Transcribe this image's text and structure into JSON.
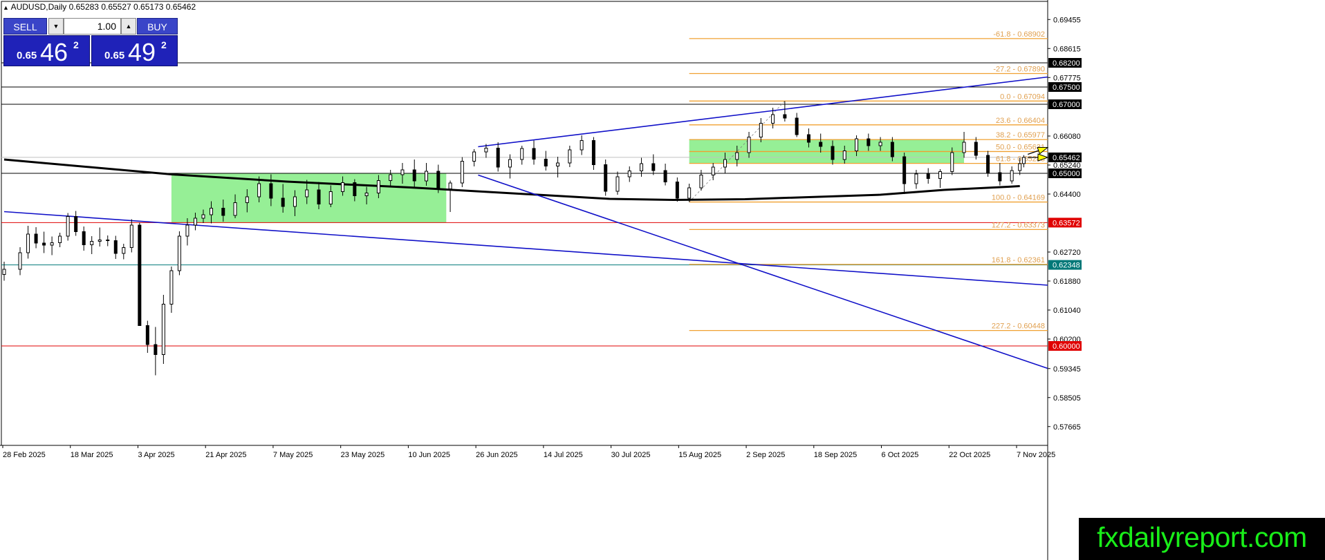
{
  "header": {
    "symbol": "AUDUSD",
    "timeframe": "Daily",
    "ohlc_text": "AUDUSD,Daily  0.65283 0.65527 0.65173 0.65462"
  },
  "trade_panel": {
    "sell_label": "SELL",
    "buy_label": "BUY",
    "lot_value": "1.00",
    "sell_small": "0.65",
    "sell_big": "46",
    "sell_sup": "2",
    "buy_small": "0.65",
    "buy_big": "49",
    "buy_sup": "2"
  },
  "watermark": "fxdailyreport.com",
  "colors": {
    "fib": "#f0a030",
    "fib_label": "#e0a050",
    "zone": "#90ee90",
    "trend": "#1010c8",
    "ma": "#000000",
    "red_line": "#e00000",
    "teal_line": "#007878",
    "level_badge": "#000000",
    "red_badge": "#e00000",
    "teal_badge": "#007878",
    "arrow": "#ffff00"
  },
  "chart_data": {
    "type": "candlestick",
    "symbol": "AUDUSD",
    "timeframe": "Daily",
    "last_price": 0.65462,
    "ohlc_last": {
      "open": 0.65283,
      "high": 0.65527,
      "low": 0.65173,
      "close": 0.65462
    },
    "ylim": [
      0.5712,
      0.6998
    ],
    "x_tick_labels": [
      "28 Feb 2025",
      "18 Mar 2025",
      "3 Apr 2025",
      "21 Apr 2025",
      "7 May 2025",
      "23 May 2025",
      "10 Jun 2025",
      "26 Jun 2025",
      "14 Jul 2025",
      "30 Jul 2025",
      "15 Aug 2025",
      "2 Sep 2025",
      "18 Sep 2025",
      "6 Oct 2025",
      "22 Oct 2025",
      "7 Nov 2025"
    ],
    "y_tick_labels": [
      "0.69455",
      "0.68615",
      "0.67775",
      "0.66080",
      "0.65240",
      "0.64400",
      "0.62720",
      "0.61880",
      "0.61040",
      "0.60200",
      "0.59345",
      "0.58505",
      "0.57665"
    ],
    "price_badges": [
      {
        "label": "0.68200",
        "value": 0.682,
        "style": "black"
      },
      {
        "label": "0.67500",
        "value": 0.675,
        "style": "black"
      },
      {
        "label": "0.67000",
        "value": 0.67,
        "style": "black"
      },
      {
        "label": "0.65462",
        "value": 0.65462,
        "style": "black"
      },
      {
        "label": "0.65000",
        "value": 0.65,
        "style": "black"
      },
      {
        "label": "0.63572",
        "value": 0.63572,
        "style": "red"
      },
      {
        "label": "0.62348",
        "value": 0.62348,
        "style": "teal"
      },
      {
        "label": "0.60000",
        "value": 0.6,
        "style": "red"
      }
    ],
    "horizontal_lines": [
      {
        "value": 0.682,
        "color": "black"
      },
      {
        "value": 0.675,
        "color": "black"
      },
      {
        "value": 0.67,
        "color": "black"
      },
      {
        "value": 0.65,
        "color": "black"
      },
      {
        "value": 0.63572,
        "color": "red"
      },
      {
        "value": 0.62348,
        "color": "teal"
      },
      {
        "value": 0.6,
        "color": "red"
      }
    ],
    "fibonacci": {
      "from_date": "19 Aug 2025",
      "levels": [
        {
          "label": "-61.8 - 0.68902",
          "value": 0.68902
        },
        {
          "label": "-27.2 - 0.67890",
          "value": 0.6789
        },
        {
          "label": "0.0 - 0.67094",
          "value": 0.67094
        },
        {
          "label": "23.6 - 0.66404",
          "value": 0.66404
        },
        {
          "label": "38.2 - 0.65977",
          "value": 0.65977
        },
        {
          "label": "50.0 - 0.65631",
          "value": 0.65631
        },
        {
          "label": "61.8 - 0.65288",
          "value": 0.65288
        },
        {
          "label": "100.0 - 0.64169",
          "value": 0.64169
        },
        {
          "label": "127.2 - 0.63373",
          "value": 0.63373
        },
        {
          "label": "161.8 - 0.62361",
          "value": 0.62361
        },
        {
          "label": "227.2 - 0.60448",
          "value": 0.60448
        }
      ]
    },
    "zones": [
      {
        "start": "11 Apr 2025",
        "end": "19 Jun 2025",
        "high": 0.65,
        "low": 0.63572
      },
      {
        "start": "19 Aug 2025",
        "end": "27 Oct 2025",
        "high": 0.65977,
        "low": 0.65288
      }
    ],
    "trendlines": [
      {
        "start": {
          "date": "28 Feb 2025",
          "price": 0.6389
        },
        "end": {
          "date": "17 Nov 2025",
          "price": 0.6176
        }
      },
      {
        "start": {
          "date": "27 Jun 2025",
          "price": 0.6577
        },
        "end": {
          "date": "17 Nov 2025",
          "price": 0.6779
        }
      },
      {
        "start": {
          "date": "27 Jun 2025",
          "price": 0.6495
        },
        "end": {
          "date": "17 Nov 2025",
          "price": 0.5935
        }
      }
    ],
    "moving_average": [
      {
        "date": "28 Feb 2025",
        "price": 0.654
      },
      {
        "date": "11 Apr 2025",
        "price": 0.6497
      },
      {
        "date": "10 May 2025",
        "price": 0.6476
      },
      {
        "date": "10 Jun 2025",
        "price": 0.6459
      },
      {
        "date": "30 Jul 2025",
        "price": 0.6426
      },
      {
        "date": "15 Aug 2025",
        "price": 0.6423
      },
      {
        "date": "2 Sep 2025",
        "price": 0.6425
      },
      {
        "date": "6 Oct 2025",
        "price": 0.6438
      },
      {
        "date": "22 Oct 2025",
        "price": 0.6452
      },
      {
        "date": "7 Nov 2025",
        "price": 0.6461
      },
      {
        "date": "10 Nov 2025",
        "price": 0.6463
      }
    ],
    "arrows": [
      {
        "start": {
          "date": "12 Nov 2025",
          "price": 0.6555
        },
        "end": {
          "date": "17 Nov 2025",
          "price": 0.6575
        }
      },
      {
        "start": {
          "date": "12 Nov 2025",
          "price": 0.6546
        },
        "end": {
          "date": "17 Nov 2025",
          "price": 0.6546
        }
      }
    ],
    "candles": [
      {
        "date": "28 Feb 2025",
        "open": 0.6207,
        "high": 0.6244,
        "low": 0.6189,
        "close": 0.6222
      },
      {
        "date": "4 Mar 2025",
        "open": 0.6222,
        "high": 0.6286,
        "low": 0.6205,
        "close": 0.627
      },
      {
        "date": "6 Mar 2025",
        "open": 0.627,
        "high": 0.6348,
        "low": 0.6253,
        "close": 0.6324
      },
      {
        "date": "8 Mar 2025",
        "open": 0.6324,
        "high": 0.6344,
        "low": 0.6283,
        "close": 0.6298
      },
      {
        "date": "10 Mar 2025",
        "open": 0.6298,
        "high": 0.6331,
        "low": 0.6269,
        "close": 0.6292
      },
      {
        "date": "12 Mar 2025",
        "open": 0.6292,
        "high": 0.6317,
        "low": 0.6263,
        "close": 0.6299
      },
      {
        "date": "14 Mar 2025",
        "open": 0.6299,
        "high": 0.6328,
        "low": 0.6286,
        "close": 0.6318
      },
      {
        "date": "16 Mar 2025",
        "open": 0.6318,
        "high": 0.6385,
        "low": 0.6305,
        "close": 0.6375
      },
      {
        "date": "18 Mar 2025",
        "open": 0.6375,
        "high": 0.6391,
        "low": 0.6319,
        "close": 0.6331
      },
      {
        "date": "20 Mar 2025",
        "open": 0.6331,
        "high": 0.6346,
        "low": 0.6276,
        "close": 0.6293
      },
      {
        "date": "22 Mar 2025",
        "open": 0.6293,
        "high": 0.6318,
        "low": 0.6266,
        "close": 0.6303
      },
      {
        "date": "24 Mar 2025",
        "open": 0.6303,
        "high": 0.6343,
        "low": 0.6288,
        "close": 0.6307
      },
      {
        "date": "26 Mar 2025",
        "open": 0.6307,
        "high": 0.632,
        "low": 0.6289,
        "close": 0.6305
      },
      {
        "date": "28 Mar 2025",
        "open": 0.6305,
        "high": 0.6319,
        "low": 0.6252,
        "close": 0.6268
      },
      {
        "date": "30 Mar 2025",
        "open": 0.6268,
        "high": 0.6296,
        "low": 0.6251,
        "close": 0.6285
      },
      {
        "date": "1 Apr 2025",
        "open": 0.6285,
        "high": 0.6367,
        "low": 0.6271,
        "close": 0.635
      },
      {
        "date": "3 Apr 2025",
        "open": 0.635,
        "high": 0.6357,
        "low": 0.6208,
        "close": 0.6059
      },
      {
        "date": "5 Apr 2025",
        "open": 0.6059,
        "high": 0.6073,
        "low": 0.598,
        "close": 0.6004
      },
      {
        "date": "7 Apr 2025",
        "open": 0.6004,
        "high": 0.6055,
        "low": 0.5915,
        "close": 0.5975
      },
      {
        "date": "9 Apr 2025",
        "open": 0.5975,
        "high": 0.6148,
        "low": 0.5948,
        "close": 0.6121
      },
      {
        "date": "11 Apr 2025",
        "open": 0.6121,
        "high": 0.623,
        "low": 0.6096,
        "close": 0.6218
      },
      {
        "date": "13 Apr 2025",
        "open": 0.6218,
        "high": 0.6332,
        "low": 0.6205,
        "close": 0.6318
      },
      {
        "date": "15 Apr 2025",
        "open": 0.6318,
        "high": 0.637,
        "low": 0.6291,
        "close": 0.635
      },
      {
        "date": "17 Apr 2025",
        "open": 0.635,
        "high": 0.6386,
        "low": 0.6335,
        "close": 0.637
      },
      {
        "date": "19 Apr 2025",
        "open": 0.637,
        "high": 0.6395,
        "low": 0.6356,
        "close": 0.638
      },
      {
        "date": "21 Apr 2025",
        "open": 0.638,
        "high": 0.6419,
        "low": 0.6355,
        "close": 0.6399
      },
      {
        "date": "24 Apr 2025",
        "open": 0.6399,
        "high": 0.6424,
        "low": 0.636,
        "close": 0.6378
      },
      {
        "date": "27 Apr 2025",
        "open": 0.6378,
        "high": 0.6439,
        "low": 0.637,
        "close": 0.6415
      },
      {
        "date": "30 Apr 2025",
        "open": 0.6415,
        "high": 0.6454,
        "low": 0.6387,
        "close": 0.6432
      },
      {
        "date": "3 May 2025",
        "open": 0.6432,
        "high": 0.6491,
        "low": 0.6416,
        "close": 0.647
      },
      {
        "date": "6 May 2025",
        "open": 0.647,
        "high": 0.6497,
        "low": 0.6405,
        "close": 0.6428
      },
      {
        "date": "9 May 2025",
        "open": 0.6428,
        "high": 0.6469,
        "low": 0.6386,
        "close": 0.6404
      },
      {
        "date": "12 May 2025",
        "open": 0.6404,
        "high": 0.6451,
        "low": 0.6376,
        "close": 0.6432
      },
      {
        "date": "15 May 2025",
        "open": 0.6432,
        "high": 0.6481,
        "low": 0.6411,
        "close": 0.6452
      },
      {
        "date": "18 May 2025",
        "open": 0.6452,
        "high": 0.6475,
        "low": 0.6396,
        "close": 0.6411
      },
      {
        "date": "21 May 2025",
        "open": 0.6411,
        "high": 0.6465,
        "low": 0.6402,
        "close": 0.6447
      },
      {
        "date": "24 May 2025",
        "open": 0.6447,
        "high": 0.6491,
        "low": 0.6435,
        "close": 0.6473
      },
      {
        "date": "27 May 2025",
        "open": 0.6473,
        "high": 0.6483,
        "low": 0.6419,
        "close": 0.6435
      },
      {
        "date": "30 May 2025",
        "open": 0.6435,
        "high": 0.6461,
        "low": 0.641,
        "close": 0.6443
      },
      {
        "date": "2 Jun 2025",
        "open": 0.6443,
        "high": 0.6495,
        "low": 0.6428,
        "close": 0.6479
      },
      {
        "date": "5 Jun 2025",
        "open": 0.6479,
        "high": 0.651,
        "low": 0.646,
        "close": 0.6496
      },
      {
        "date": "8 Jun 2025",
        "open": 0.6496,
        "high": 0.653,
        "low": 0.647,
        "close": 0.651
      },
      {
        "date": "11 Jun 2025",
        "open": 0.651,
        "high": 0.654,
        "low": 0.646,
        "close": 0.6478
      },
      {
        "date": "14 Jun 2025",
        "open": 0.6478,
        "high": 0.653,
        "low": 0.6464,
        "close": 0.6506
      },
      {
        "date": "17 Jun 2025",
        "open": 0.6506,
        "high": 0.6525,
        "low": 0.6443,
        "close": 0.6455
      },
      {
        "date": "20 Jun 2025",
        "open": 0.6455,
        "high": 0.6479,
        "low": 0.6388,
        "close": 0.6472
      },
      {
        "date": "23 Jun 2025",
        "open": 0.6472,
        "high": 0.6547,
        "low": 0.646,
        "close": 0.6535
      },
      {
        "date": "26 Jun 2025",
        "open": 0.6535,
        "high": 0.657,
        "low": 0.652,
        "close": 0.6562
      },
      {
        "date": "29 Jun 2025",
        "open": 0.6562,
        "high": 0.6585,
        "low": 0.6545,
        "close": 0.6573
      },
      {
        "date": "2 Jul 2025",
        "open": 0.6573,
        "high": 0.659,
        "low": 0.6505,
        "close": 0.6518
      },
      {
        "date": "5 Jul 2025",
        "open": 0.6518,
        "high": 0.6555,
        "low": 0.6485,
        "close": 0.654
      },
      {
        "date": "8 Jul 2025",
        "open": 0.654,
        "high": 0.658,
        "low": 0.6525,
        "close": 0.6572
      },
      {
        "date": "11 Jul 2025",
        "open": 0.6572,
        "high": 0.6595,
        "low": 0.6525,
        "close": 0.6541
      },
      {
        "date": "14 Jul 2025",
        "open": 0.6541,
        "high": 0.6565,
        "low": 0.6508,
        "close": 0.6521
      },
      {
        "date": "17 Jul 2025",
        "open": 0.6521,
        "high": 0.6548,
        "low": 0.6488,
        "close": 0.653
      },
      {
        "date": "20 Jul 2025",
        "open": 0.653,
        "high": 0.658,
        "low": 0.6518,
        "close": 0.6568
      },
      {
        "date": "23 Jul 2025",
        "open": 0.6568,
        "high": 0.661,
        "low": 0.6553,
        "close": 0.6595
      },
      {
        "date": "26 Jul 2025",
        "open": 0.6595,
        "high": 0.6605,
        "low": 0.651,
        "close": 0.6525
      },
      {
        "date": "29 Jul 2025",
        "open": 0.6525,
        "high": 0.654,
        "low": 0.6435,
        "close": 0.6448
      },
      {
        "date": "1 Aug 2025",
        "open": 0.6448,
        "high": 0.6505,
        "low": 0.6438,
        "close": 0.649
      },
      {
        "date": "4 Aug 2025",
        "open": 0.649,
        "high": 0.652,
        "low": 0.6475,
        "close": 0.6507
      },
      {
        "date": "7 Aug 2025",
        "open": 0.6507,
        "high": 0.6545,
        "low": 0.649,
        "close": 0.6528
      },
      {
        "date": "10 Aug 2025",
        "open": 0.6528,
        "high": 0.6555,
        "low": 0.6495,
        "close": 0.6508
      },
      {
        "date": "13 Aug 2025",
        "open": 0.6508,
        "high": 0.6528,
        "low": 0.6465,
        "close": 0.6475
      },
      {
        "date": "16 Aug 2025",
        "open": 0.6475,
        "high": 0.6488,
        "low": 0.6418,
        "close": 0.6428
      },
      {
        "date": "19 Aug 2025",
        "open": 0.6428,
        "high": 0.647,
        "low": 0.6417,
        "close": 0.6458
      },
      {
        "date": "22 Aug 2025",
        "open": 0.6458,
        "high": 0.651,
        "low": 0.645,
        "close": 0.6495
      },
      {
        "date": "25 Aug 2025",
        "open": 0.6495,
        "high": 0.653,
        "low": 0.648,
        "close": 0.6518
      },
      {
        "date": "28 Aug 2025",
        "open": 0.6518,
        "high": 0.656,
        "low": 0.65,
        "close": 0.654
      },
      {
        "date": "31 Aug 2025",
        "open": 0.654,
        "high": 0.658,
        "low": 0.652,
        "close": 0.656
      },
      {
        "date": "3 Sep 2025",
        "open": 0.656,
        "high": 0.662,
        "low": 0.6545,
        "close": 0.6605
      },
      {
        "date": "6 Sep 2025",
        "open": 0.6605,
        "high": 0.666,
        "low": 0.659,
        "close": 0.6645
      },
      {
        "date": "9 Sep 2025",
        "open": 0.6645,
        "high": 0.669,
        "low": 0.663,
        "close": 0.667
      },
      {
        "date": "12 Sep 2025",
        "open": 0.667,
        "high": 0.6709,
        "low": 0.665,
        "close": 0.666
      },
      {
        "date": "15 Sep 2025",
        "open": 0.666,
        "high": 0.6675,
        "low": 0.6605,
        "close": 0.6612
      },
      {
        "date": "18 Sep 2025",
        "open": 0.6612,
        "high": 0.663,
        "low": 0.6575,
        "close": 0.659
      },
      {
        "date": "21 Sep 2025",
        "open": 0.659,
        "high": 0.6615,
        "low": 0.656,
        "close": 0.6578
      },
      {
        "date": "24 Sep 2025",
        "open": 0.6578,
        "high": 0.6595,
        "low": 0.6525,
        "close": 0.654
      },
      {
        "date": "27 Sep 2025",
        "open": 0.654,
        "high": 0.658,
        "low": 0.6528,
        "close": 0.6565
      },
      {
        "date": "30 Sep 2025",
        "open": 0.6565,
        "high": 0.661,
        "low": 0.655,
        "close": 0.66
      },
      {
        "date": "3 Oct 2025",
        "open": 0.66,
        "high": 0.6615,
        "low": 0.6565,
        "close": 0.658
      },
      {
        "date": "6 Oct 2025",
        "open": 0.658,
        "high": 0.6605,
        "low": 0.6565,
        "close": 0.659
      },
      {
        "date": "9 Oct 2025",
        "open": 0.659,
        "high": 0.6605,
        "low": 0.6535,
        "close": 0.6548
      },
      {
        "date": "12 Oct 2025",
        "open": 0.6548,
        "high": 0.656,
        "low": 0.644,
        "close": 0.647
      },
      {
        "date": "15 Oct 2025",
        "open": 0.647,
        "high": 0.651,
        "low": 0.6455,
        "close": 0.6498
      },
      {
        "date": "18 Oct 2025",
        "open": 0.6498,
        "high": 0.6515,
        "low": 0.647,
        "close": 0.6485
      },
      {
        "date": "21 Oct 2025",
        "open": 0.6485,
        "high": 0.6512,
        "low": 0.6458,
        "close": 0.6505
      },
      {
        "date": "24 Oct 2025",
        "open": 0.6505,
        "high": 0.6575,
        "low": 0.6495,
        "close": 0.656
      },
      {
        "date": "27 Oct 2025",
        "open": 0.656,
        "high": 0.662,
        "low": 0.6545,
        "close": 0.659
      },
      {
        "date": "30 Oct 2025",
        "open": 0.659,
        "high": 0.6605,
        "low": 0.654,
        "close": 0.6552
      },
      {
        "date": "2 Nov 2025",
        "open": 0.6552,
        "high": 0.6565,
        "low": 0.649,
        "close": 0.6502
      },
      {
        "date": "5 Nov 2025",
        "open": 0.6502,
        "high": 0.653,
        "low": 0.6465,
        "close": 0.6478
      },
      {
        "date": "8 Nov 2025",
        "open": 0.6478,
        "high": 0.652,
        "low": 0.647,
        "close": 0.6508
      },
      {
        "date": "10 Nov 2025",
        "open": 0.6508,
        "high": 0.6545,
        "low": 0.6495,
        "close": 0.6528
      },
      {
        "date": "11 Nov 2025",
        "open": 0.65283,
        "high": 0.65527,
        "low": 0.65173,
        "close": 0.65462
      }
    ]
  }
}
